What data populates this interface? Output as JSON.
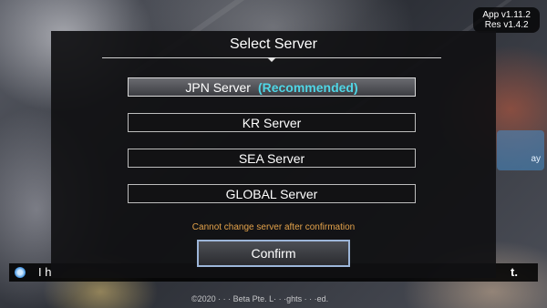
{
  "version": {
    "app": "App v1.11.2",
    "res": "Res v1.4.2"
  },
  "background": {
    "notice_left": "I h",
    "notice_right": "t.",
    "side_label": "ay",
    "copyright": "©2020 · · · Beta Pte. L· · ·ghts · · ·ed."
  },
  "dialog": {
    "title": "Select Server",
    "servers": [
      {
        "label": "JPN Server",
        "tag": "(Recommended)",
        "selected": true
      },
      {
        "label": "KR Server",
        "tag": "",
        "selected": false
      },
      {
        "label": "SEA Server",
        "tag": "",
        "selected": false
      },
      {
        "label": "GLOBAL Server",
        "tag": "",
        "selected": false
      }
    ],
    "warning": "Cannot change server after confirmation",
    "confirm_label": "Confirm"
  },
  "colors": {
    "recommended": "#4fd6e6",
    "warning": "#e3a24a",
    "confirm_border": "#9db6d9"
  }
}
